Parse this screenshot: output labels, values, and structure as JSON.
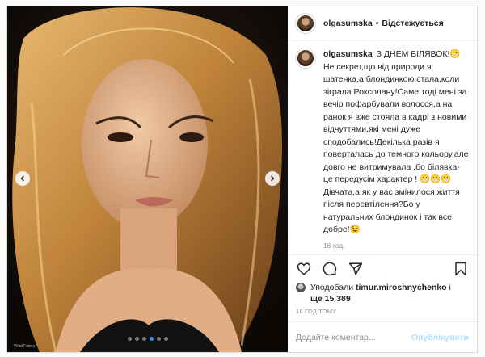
{
  "account": {
    "username": "olgasumska",
    "separator": "•",
    "follow_label": "Відстежується"
  },
  "caption": {
    "text": "З ДНЕМ БІЛЯВОК!😬Не секрет,що від природи я шатенка,а блондинкою стала,коли зіграла Роксолану!Саме тоді мені за вечір пофарбували волосся,а на ранок я вже стояла в кадрі з новими відчуттями,які мені дуже сподобались!Декілька разів я поверталась до темного кольору,але довго не витримувала ,бо білявка-це передусім характер ! 😬😬😬Дівчата,а як у вас змінилося життя після перевтілення?Бо у натуральних блондинок і так все добре!😉",
    "age": "16 год."
  },
  "carousel": {
    "total": 6,
    "active_index": 3,
    "credit": "Vitali Fotina"
  },
  "likes": {
    "prefix": "Уподобали",
    "user": "timur.miroshnychenko",
    "suffix": "і",
    "more": "ще 15 389"
  },
  "timestamp": "16 год тому",
  "comment": {
    "placeholder": "Додайте коментар...",
    "publish_label": "Опублікувати"
  },
  "icons": {
    "like": "heart-icon",
    "comment": "comment-icon",
    "share": "share-icon",
    "save": "bookmark-icon",
    "more": "plus-circle-icon",
    "prev": "chevron-left-icon",
    "next": "chevron-right-icon"
  },
  "colors": {
    "accent": "#3897f0",
    "publish_disabled": "#b2dffc",
    "muted": "#8e8e8e"
  }
}
